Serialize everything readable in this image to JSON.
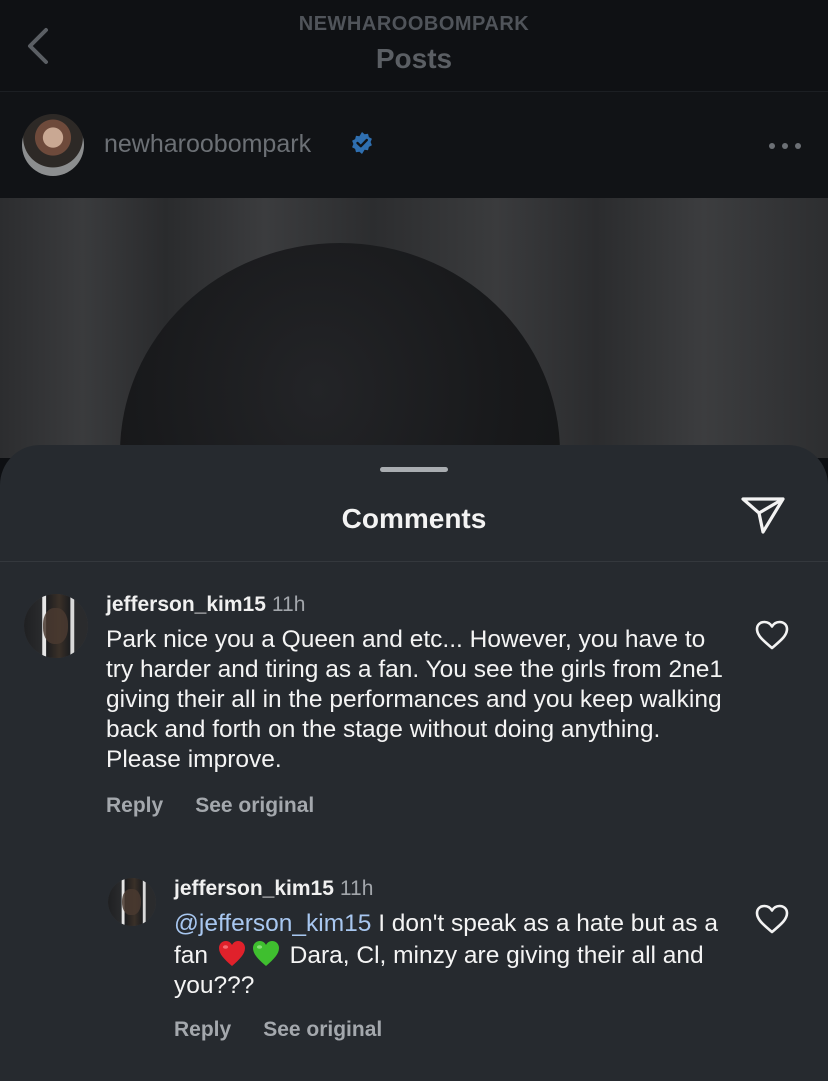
{
  "nav": {
    "account_handle": "NEWHAROOBOMPARK",
    "title": "Posts"
  },
  "post": {
    "username": "newharoobompark",
    "verified": true
  },
  "comments_sheet": {
    "title": "Comments",
    "comments": [
      {
        "username": "jefferson_kim15",
        "time": "11h",
        "text": "Park nice you a Queen and etc... However, you have to try harder and tiring as a fan. You see the girls from 2ne1 giving their all in the performances and you keep walking back and forth on the stage without doing anything. Please improve.",
        "reply_label": "Reply",
        "see_original_label": "See original"
      }
    ],
    "reply": {
      "username": "jefferson_kim15",
      "time": "11h",
      "mention": "@jefferson_kim15",
      "text_part1": " I don't speak as a hate but as a fan ",
      "text_part2": " Dara, Cl, minzy are giving their all and you???",
      "emojis": [
        "red-heart-emoji",
        "green-heart-emoji"
      ],
      "reply_label": "Reply",
      "see_original_label": "See original"
    }
  },
  "icons": {
    "back": "chevron-left-icon",
    "verified": "verified-badge-icon",
    "more": "more-horizontal-icon",
    "share": "send-icon",
    "like": "heart-outline-icon"
  },
  "colors": {
    "sheet_background": "#262a2f",
    "verified_blue": "#3897f0",
    "mention_blue": "#a8c7f0",
    "secondary_text": "#a4a8ad"
  }
}
